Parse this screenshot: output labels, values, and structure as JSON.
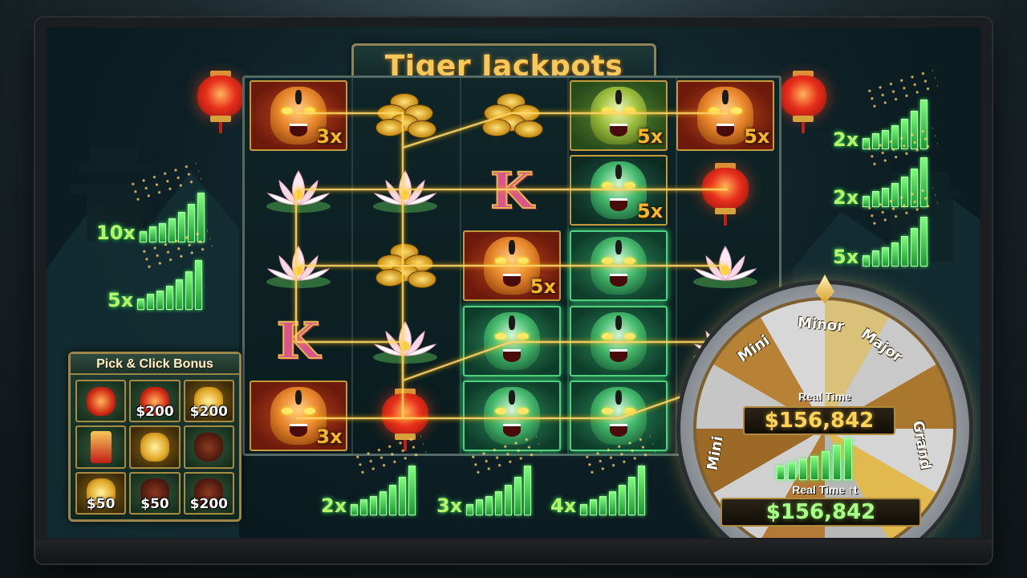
{
  "title": "Tiger Jackpots",
  "reels": [
    [
      {
        "sym": "tiger-orange",
        "mult": "3x"
      },
      {
        "sym": "lotus"
      },
      {
        "sym": "lotus"
      },
      {
        "sym": "k"
      },
      {
        "sym": "tiger-orange",
        "mult": "3x"
      }
    ],
    [
      {
        "sym": "coins"
      },
      {
        "sym": "lotus"
      },
      {
        "sym": "coins"
      },
      {
        "sym": "lotus"
      },
      {
        "sym": "lantern"
      }
    ],
    [
      {
        "sym": "coins"
      },
      {
        "sym": "k"
      },
      {
        "sym": "tiger-orange",
        "mult": "5x"
      },
      {
        "sym": "tiger-green"
      },
      {
        "sym": "tiger-green"
      }
    ],
    [
      {
        "sym": "tiger-yellow",
        "mult": "5x"
      },
      {
        "sym": "tiger-green",
        "mult": "5x"
      },
      {
        "sym": "tiger-green"
      },
      {
        "sym": "tiger-green"
      },
      {
        "sym": "tiger-green"
      }
    ],
    [
      {
        "sym": "tiger-orange",
        "mult": "5x"
      },
      {
        "sym": "lantern"
      },
      {
        "sym": "lotus"
      },
      {
        "sym": "lotus"
      },
      {
        "sym": "empty"
      }
    ]
  ],
  "left_multipliers": [
    {
      "label": "10x"
    },
    {
      "label": "5x"
    }
  ],
  "right_multipliers": [
    {
      "label": "2x"
    },
    {
      "label": "2x"
    },
    {
      "label": "5x"
    }
  ],
  "bottom_multipliers": [
    {
      "label": "2x"
    },
    {
      "label": "3x"
    },
    {
      "label": "4x"
    }
  ],
  "pick_click": {
    "title": "Pick & Click Bonus",
    "cells": [
      {
        "icon": "lantern-icon",
        "value": ""
      },
      {
        "icon": "lantern-icon",
        "value": "$200"
      },
      {
        "icon": "gold-ingot-icon",
        "value": "$200"
      },
      {
        "icon": "firecracker-icon",
        "value": ""
      },
      {
        "icon": "gold-ingot-icon",
        "value": ""
      },
      {
        "icon": "treasure-pot-icon",
        "value": ""
      },
      {
        "icon": "gold-ingot-icon",
        "value": "$50"
      },
      {
        "icon": "treasure-pot-icon",
        "value": "$50"
      },
      {
        "icon": "treasure-pot-icon",
        "value": "$200"
      }
    ]
  },
  "wheel": {
    "segments": [
      "Mini",
      "Minor",
      "Major",
      "Grand",
      "Mini"
    ],
    "realtime_label_1": "Real Time",
    "realtime_value_1": "$156,842",
    "realtime_label_2": "Real Time ↑t",
    "realtime_value_2": "$156,842"
  },
  "colors": {
    "accent_gold": "#f7c85a",
    "multiplier_green": "#7dff7a",
    "payline": "#ffd66a"
  }
}
